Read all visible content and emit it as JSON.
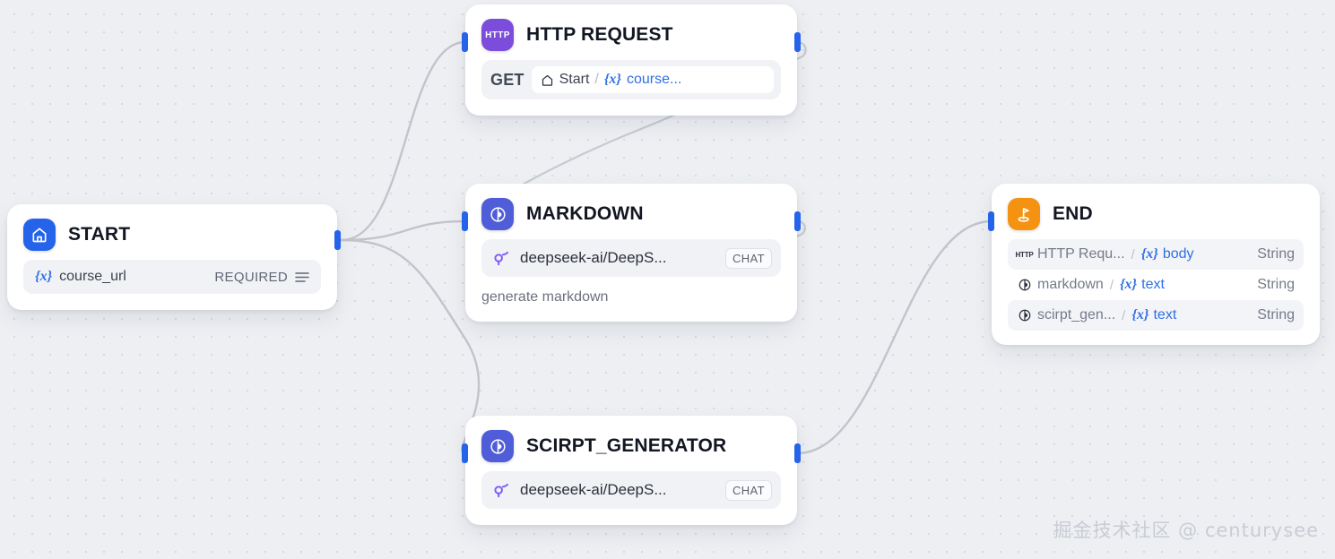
{
  "canvas": {
    "background_color": "#edeff3",
    "dot_color": "#d6d9e0",
    "accent_color": "#2563eb",
    "edge_color": "#c2c4cc"
  },
  "watermark": {
    "text": "掘金技术社区 @ centurysee"
  },
  "nodes": {
    "start": {
      "title": "START",
      "icon": "home-icon",
      "icon_color": "#2563eb",
      "variable": {
        "token": "{x}",
        "name": "course_url",
        "required_label": "REQUIRED",
        "type_icon": "text-lines-icon"
      }
    },
    "http_request": {
      "title": "HTTP REQUEST",
      "icon": "http-icon",
      "icon_label": "HTTP",
      "icon_color": "#7c4ddb",
      "method": "GET",
      "url": {
        "source_icon": "home-icon",
        "source_label": "Start",
        "separator": "/",
        "token": "{x}",
        "variable": "course..."
      }
    },
    "markdown": {
      "title": "MARKDOWN",
      "icon": "llm-icon",
      "icon_color": "#4f5ed8",
      "model": {
        "provider_icon": "deepseek-icon",
        "name": "deepseek-ai/DeepS...",
        "badge": "CHAT"
      },
      "description": "generate markdown"
    },
    "scirpt_generator": {
      "title": "SCIRPT_GENERATOR",
      "icon": "llm-icon",
      "icon_color": "#4f5ed8",
      "model": {
        "provider_icon": "deepseek-icon",
        "name": "deepseek-ai/DeepS...",
        "badge": "CHAT"
      }
    },
    "end": {
      "title": "END",
      "icon": "goal-flag-icon",
      "icon_color": "#f59211",
      "outputs": [
        {
          "source_icon": "http-mini-icon",
          "source": "HTTP Requ...",
          "separator": "/",
          "token": "{x}",
          "variable": "body",
          "type": "String"
        },
        {
          "source_icon": "llm-mini-icon",
          "source": "markdown",
          "separator": "/",
          "token": "{x}",
          "variable": "text",
          "type": "String"
        },
        {
          "source_icon": "llm-mini-icon",
          "source": "scirpt_gen...",
          "separator": "/",
          "token": "{x}",
          "variable": "text",
          "type": "String"
        }
      ]
    }
  }
}
